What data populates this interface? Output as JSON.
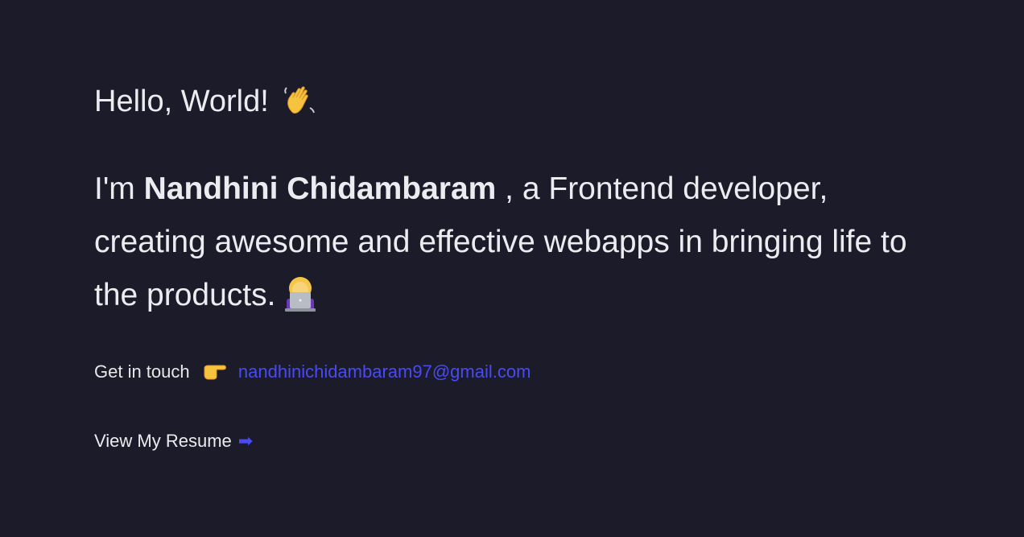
{
  "hero": {
    "greeting": "Hello, World!",
    "greeting_icon": "waving-hand-icon",
    "intro_prefix": "I'm ",
    "name": "Nandhini Chidambaram",
    "intro_suffix": " , a Frontend developer, creating awesome and effective webapps in bringing life to the products.",
    "intro_icon": "woman-technologist-icon",
    "touch_label": "Get in touch",
    "touch_icon": "pointing-right-icon",
    "email": "nandhinichidambaram97@gmail.com",
    "resume_label": "View My Resume",
    "resume_icon": "arrow-right-icon"
  },
  "colors": {
    "background": "#1b1b2a",
    "text": "#ececf0",
    "accent": "#4a4af5"
  }
}
